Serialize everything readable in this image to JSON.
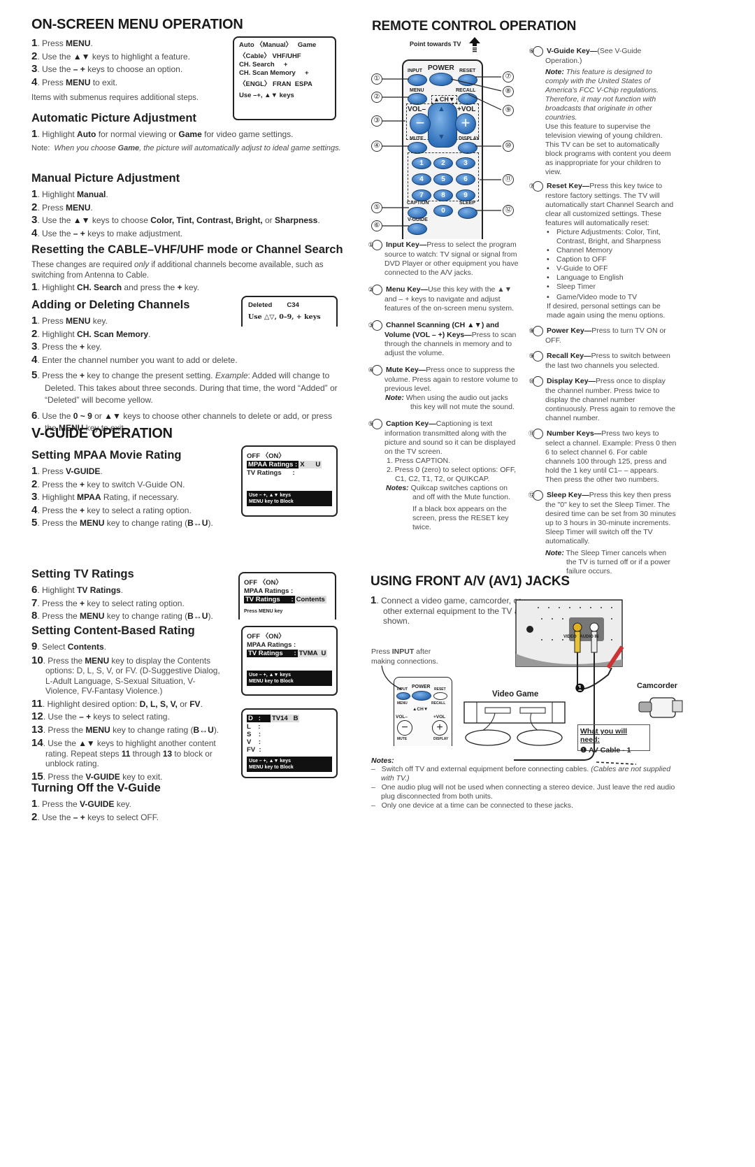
{
  "left": {
    "onscreen": {
      "title": "ON-SCREEN MENU OPERATION",
      "steps": [
        {
          "n": "1",
          "pre": "Press ",
          "b": "MENU",
          "post": "."
        },
        {
          "n": "2",
          "pre": "Use the ",
          "b": "▲▼",
          "post": " keys to highlight a feature."
        },
        {
          "n": "3",
          "pre": "Use the ",
          "b": "– +",
          "post": " keys to choose an option."
        },
        {
          "n": "4",
          "pre": "Press ",
          "b": "MENU",
          "post": " to exit."
        }
      ],
      "footnote": "Items with submenus requires additional steps.",
      "osd": [
        "Auto 〈Manual〉   Game",
        "〈Cable〉 VHF/UHF",
        "CH. Search     +",
        "CH. Scan Memory     +",
        "〈ENGL〉 FRAN  ESPA",
        "Use –+, ▲▼ keys"
      ]
    },
    "auto_pic": {
      "title": "Automatic Picture Adjustment",
      "step": {
        "n": "1",
        "pre": "Highlight ",
        "b1": "Auto",
        "mid": " for normal viewing or ",
        "b2": "Game",
        "post": " for video game settings."
      },
      "note_label": "Note:",
      "note_pre": "When you choose ",
      "note_b": "Game",
      "note_post": ", the picture will automatically adjust to ideal game settings."
    },
    "manual_pic": {
      "title": "Manual Picture Adjustment",
      "steps": [
        {
          "n": "1",
          "pre": "Highlight ",
          "b": "Manual",
          "post": "."
        },
        {
          "n": "2",
          "pre": "Press ",
          "b": "MENU",
          "post": "."
        },
        {
          "n": "3",
          "pre": "Use the ",
          "b": "▲▼",
          "post": " keys to choose ",
          "b2": "Color, Tint, Contrast, Bright,",
          "post2": " or ",
          "b3": "Sharpness",
          "post3": "."
        },
        {
          "n": "4",
          "pre": "Use the ",
          "b": "– +",
          "post": " keys to make adjustment."
        }
      ]
    },
    "resetting": {
      "title": "Resetting the CABLE–VHF/UHF mode or Channel Search",
      "para_pre": "These changes are required ",
      "para_i": "only",
      "para_post": " if additional channels become available, such as switching from Antenna to Cable.",
      "step": {
        "n": "1",
        "pre": "Highlight ",
        "b": "CH. Search",
        "post": " and press the ",
        "b2": "+",
        "post2": " key."
      }
    },
    "adding": {
      "title": "Adding or Deleting Channels",
      "osd": [
        "Deleted        C34",
        "Use △▽, 0–9, + keys"
      ],
      "steps": [
        {
          "n": "1",
          "pre": "Press ",
          "b": "MENU",
          "post": " key."
        },
        {
          "n": "2",
          "pre": "Highlight ",
          "b": "CH. Scan Memory",
          "post": "."
        },
        {
          "n": "3",
          "pre": "Press the ",
          "b": "+",
          "post": " key."
        },
        {
          "n": "4",
          "pre": "Enter the channel number you want to add or delete.",
          "b": "",
          "post": ""
        },
        {
          "n": "5",
          "pre": "Press the ",
          "b": "+",
          "post": " key to change the present setting.  ",
          "i": "Example",
          "post2": ": Added will change to Deleted. This takes about three seconds. During that time, the word “Added” or “Deleted” will become yellow."
        },
        {
          "n": "6",
          "pre": "Use the ",
          "b": "0 ~ 9",
          "post": " or ",
          "b2": "▲▼",
          "post2": " keys to choose other channels to delete or add, or press the ",
          "b3": "MENU",
          "post3": " key to exit."
        }
      ]
    },
    "vguide": {
      "title": "V-GUIDE OPERATION",
      "mpaa": {
        "title": "Setting MPAA Movie Rating",
        "steps": [
          {
            "n": "1",
            "pre": "Press ",
            "b": "V-GUIDE",
            "post": "."
          },
          {
            "n": "2",
            "pre": "Press the  ",
            "b": "+",
            "post": "  key to switch V-Guide ON."
          },
          {
            "n": "3",
            "pre": "Highlight ",
            "b": "MPAA",
            "post": " Rating, if necessary."
          },
          {
            "n": "4",
            "pre": "Press the ",
            "b": "+",
            "post": " key to select a rating option."
          },
          {
            "n": "5",
            "pre": "Press the ",
            "b": "MENU",
            "post": " key to change rating (",
            "b2": "B↔U",
            "post2": ")."
          }
        ],
        "osd": {
          "line1": "OFF 〈ON〉",
          "hl_label": "MPAA Ratings :",
          "hl_value": "X      U",
          "line3": "TV Ratings      :",
          "bar1": "Use – +, ▲▼ keys",
          "bar2": "MENU key to Block"
        }
      },
      "tv": {
        "title": "Setting TV Ratings",
        "steps": [
          {
            "n": "6",
            "pre": "Highlight ",
            "b": "TV Ratings",
            "post": "."
          },
          {
            "n": "7",
            "pre": "Press the ",
            "b": "+",
            "post": " key to select rating option."
          },
          {
            "n": "8",
            "pre": "Press the ",
            "b": "MENU",
            "post": " key to change rating (",
            "b2": "B↔U",
            "post2": ")."
          }
        ],
        "osd": {
          "line1": "OFF 〈ON〉",
          "line2": "MPAA Ratings :",
          "hl_label": "TV Ratings      :",
          "hl_value": "Contents",
          "bar": "Press MENU key"
        }
      },
      "content": {
        "title": "Setting Content-Based Rating",
        "steps": [
          {
            "n": "9",
            "pre": "Select ",
            "b": "Contents",
            "post": "."
          },
          {
            "n": "10",
            "pre": "Press the ",
            "b": "MENU",
            "post": " key to display the Contents options: D, L, S, V, or FV. (D-Suggestive Dialog, L-Adult Language, S-Sexual Situation, V-Violence, FV-Fantasy Violence.)"
          },
          {
            "n": "11",
            "pre": "Highlight desired option: ",
            "b": "D, L, S, V,",
            "post": " or ",
            "b2": "FV",
            "post2": "."
          },
          {
            "n": "12",
            "pre": "Use the ",
            "b": "– +",
            "post": " keys to select rating."
          },
          {
            "n": "13",
            "pre": "Press the ",
            "b": "MENU",
            "post": " key to change rating (",
            "b2": "B↔U",
            "post2": ")."
          },
          {
            "n": "14",
            "pre": "Use the ",
            "b": "▲▼",
            "post": " keys to highlight another content rating. Repeat steps ",
            "b2": "11",
            "post2": " through ",
            "b3": "13",
            "post3": " to block or unblock rating."
          },
          {
            "n": "15",
            "pre": "Press the ",
            "b": "V-GUIDE",
            "post": " key to exit."
          }
        ],
        "osd1": {
          "line1": "OFF 〈ON〉",
          "line2": "MPAA Ratings :",
          "hl_label": "TV Ratings      :",
          "hl_value": "TVMA  U",
          "bar1": "Use – +, ▲▼ keys",
          "bar2": "MENU key to Block"
        },
        "osd2": {
          "hl_label": "D   :",
          "hl_value": "TV14   B",
          "rows": [
            "L    :",
            "S    :",
            "V    :",
            "FV  :"
          ],
          "bar1": "Use – +, ▲▼ keys",
          "bar2": "MENU key to Block"
        }
      },
      "off": {
        "title": "Turning Off the V-Guide",
        "steps": [
          {
            "n": "1",
            "pre": "Press the ",
            "b": "V-GUIDE",
            "post": " key."
          },
          {
            "n": "2",
            "pre": "Use the ",
            "b": "– +",
            "post": " keys to select OFF."
          }
        ]
      }
    }
  },
  "right": {
    "remote": {
      "title": "REMOTE CONTROL OPERATION",
      "point": "Point towards TV",
      "labels": {
        "input": "INPUT",
        "power": "POWER",
        "reset": "RESET",
        "menu": "MENU",
        "recall": "RECALL",
        "ch": "▲CH▼",
        "vol_minus": "VOL–",
        "vol_plus": "+VOL",
        "mute": "MUTE",
        "display": "DISPLAY",
        "caption": "CAPTION",
        "sleep": "SLEEP",
        "vguide": "V-GUIDE"
      },
      "number_keys": [
        "1",
        "2",
        "3",
        "4",
        "5",
        "6",
        "7",
        "8",
        "9",
        "0"
      ],
      "callouts_left": [
        "①",
        "②",
        "③",
        "④",
        "⑤",
        "⑥"
      ],
      "callouts_right": [
        "⑦",
        "⑧",
        "⑨",
        "⑩",
        "⑪",
        "⑫"
      ],
      "keys_col1": [
        {
          "num": "①",
          "title": "Input Key—",
          "text": "Press to select the program source to watch: TV signal or signal from DVD Player or other equipment you have connected to the A/V jacks."
        },
        {
          "num": "②",
          "title": "Menu Key—",
          "text": "Use this key with the ▲▼ and – + keys to navigate and adjust features of the on-screen menu system."
        },
        {
          "num": "③",
          "title": "Channel Scanning (CH ▲▼) and Volume (VOL – +) Keys—",
          "text": "Press to scan through the channels in memory and to adjust the volume."
        },
        {
          "num": "④",
          "title": "Mute Key—",
          "text": "Press once to suppress the volume. Press again to restore volume to previous level.",
          "note_label": "Note:",
          "note": "When using the audio out jacks this key will not mute the sound."
        },
        {
          "num": "⑤",
          "title": "Caption Key—",
          "text": "Captioning is text information transmitted along with the picture and sound so it can be displayed on the TV screen.",
          "sub": [
            "1. Press CAPTION.",
            "2. Press 0 (zero) to select options: OFF, C1, C2, T1, T2, or QUIKCAP."
          ],
          "note_label": "Notes:",
          "notes": [
            "Quikcap switches captions on and off with the Mute function.",
            "If a black box appears on the screen, press the RESET key twice."
          ]
        }
      ],
      "keys_col2": [
        {
          "num": "⑥",
          "title": "V-Guide Key—",
          "text": "(See V-Guide Operation.)",
          "note_label": "Note:",
          "note": "This feature is designed to comply with the United States of America's FCC V-Chip regulations. Therefore, it may not function with broadcasts that originate in other countries.",
          "text2": "Use this feature to supervise the television viewing of young children. This TV can be set to automatically block programs with content you deem as inappropriate for your children to view."
        },
        {
          "num": "⑦",
          "title": "Reset Key—",
          "text": "Press this key twice to restore factory settings. The TV will automatically start Channel Search and clear all customized settings. These features will automatically reset:",
          "bullets": [
            "Picture Adjustments: Color, Tint, Contrast, Bright, and Sharpness",
            "Channel Memory",
            "Caption to OFF",
            "V-Guide to OFF",
            "Language to English",
            "Sleep Timer",
            "Game/Video mode to TV"
          ],
          "text2": "If desired, personal settings can be made again using the menu options."
        },
        {
          "num": "⑧",
          "title": "Power Key—",
          "text": "Press to turn TV ON or OFF."
        },
        {
          "num": "⑨",
          "title": "Recall Key—",
          "text": "Press to switch between the last two channels you selected."
        },
        {
          "num": "⑩",
          "title": "Display Key—",
          "text": "Press once to display the channel number. Press twice to display the channel number continuously. Press again to remove the channel number."
        },
        {
          "num": "⑪",
          "title": "Number Keys—",
          "text": "Press two keys to select a channel. Example: Press 0 then 6 to select channel 6. For cable channels 100 through 125, press and hold the 1 key until C1– – appears. Then press the other two numbers."
        },
        {
          "num": "⑫",
          "title": "Sleep Key—",
          "text": "Press this key then press the \"0\" key to set the Sleep Timer. The desired time can be set from 30 minutes up to 3 hours in 30-minute increments. Sleep Timer will switch off the TV automatically.",
          "note_label": "Note:",
          "note": "The Sleep Timer cancels when the TV is turned off or if a power failure occurs."
        }
      ]
    },
    "av": {
      "title": "USING FRONT A/V (AV1) JACKS",
      "step": {
        "n": "1",
        "text": "Connect a video game, camcorder, or other external equipment to the TV as shown."
      },
      "press_pre": "Press ",
      "press_b": "INPUT",
      "press_post": " after making connections.",
      "video_game": "Video Game",
      "camcorder": "Camcorder",
      "jack_label": "VIDEO   AUDIO IN",
      "cable_marker": "❶",
      "need_title": "What you will need:",
      "need_item": "❶ AV Cable - 1",
      "notes_label": "Notes:",
      "notes": [
        {
          "text": "Switch off TV and external equipment before connecting cables. ",
          "i": "(Cables are not supplied with TV.)"
        },
        {
          "text": "One audio plug will not be used when connecting a stereo device. Just leave the red audio plug disconnected from both units.",
          "i": ""
        },
        {
          "text": "Only one device at a time can be connected to these jacks.",
          "i": ""
        }
      ]
    }
  }
}
